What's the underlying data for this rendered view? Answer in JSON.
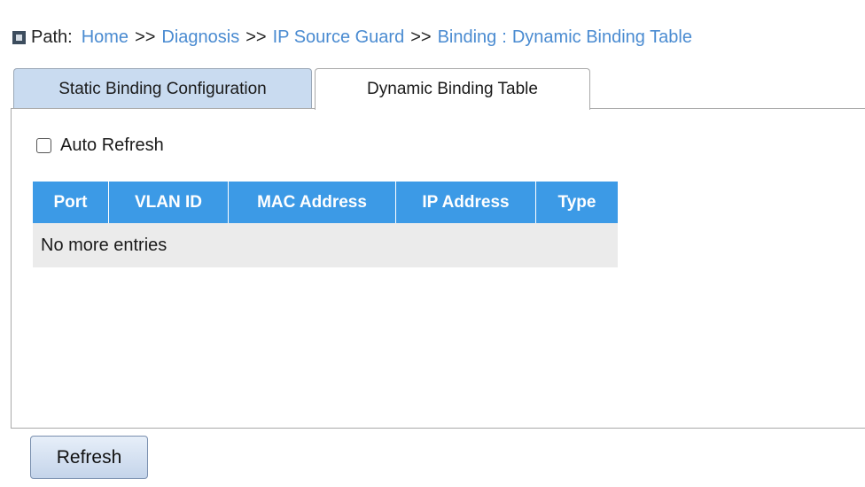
{
  "path": {
    "label": "Path:",
    "crumbs": [
      "Home",
      "Diagnosis",
      "IP Source Guard",
      "Binding"
    ],
    "separator": ">>",
    "colon": ":",
    "current": "Dynamic Binding Table"
  },
  "tabs": [
    {
      "label": "Static Binding Configuration",
      "active": false
    },
    {
      "label": "Dynamic Binding Table",
      "active": true
    }
  ],
  "auto_refresh": {
    "label": "Auto Refresh",
    "checked": false
  },
  "table": {
    "columns": [
      "Port",
      "VLAN ID",
      "MAC Address",
      "IP Address",
      "Type"
    ],
    "empty_text": "No more entries"
  },
  "buttons": {
    "refresh": "Refresh"
  },
  "colors": {
    "header_bg": "#3c9ae6",
    "link": "#4a8bd1",
    "inactive_tab": "#c9dbf0",
    "empty_row": "#ebebeb"
  }
}
